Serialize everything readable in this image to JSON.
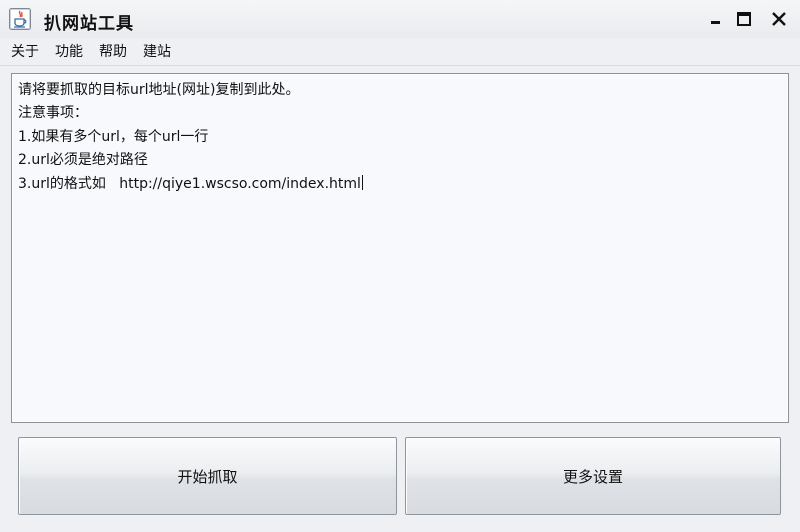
{
  "window": {
    "title": "扒网站工具",
    "icon": "java-app-icon",
    "controls": [
      "minimize-icon",
      "maximize-icon",
      "close-icon"
    ]
  },
  "menu": {
    "items": [
      {
        "label": "关于"
      },
      {
        "label": "功能"
      },
      {
        "label": "帮助"
      },
      {
        "label": "建站"
      }
    ]
  },
  "textarea": {
    "lines": [
      "请将要抓取的目标url地址(网址)复制到此处。",
      "注意事项：",
      "1.如果有多个url，每个url一行",
      "2.url必须是绝对路径",
      "3.url的格式如   http://qiye1.wscso.com/index.html"
    ]
  },
  "buttons": {
    "start_label": "开始抓取",
    "settings_label": "更多设置"
  },
  "colors": {
    "window_bg": "#eef0f3",
    "textarea_bg": "#f7f9fd",
    "border": "#8d9299"
  }
}
